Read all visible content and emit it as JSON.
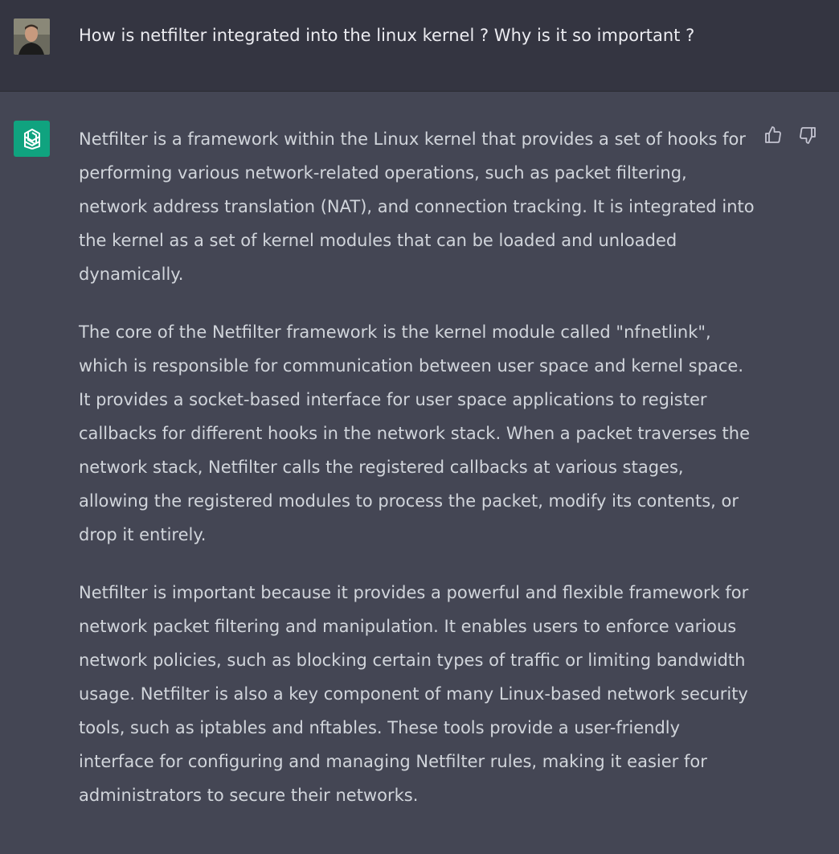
{
  "user_message": {
    "text": "How is netfilter integrated into the linux kernel ? Why is it so important ?"
  },
  "assistant_message": {
    "paragraphs": [
      "Netfilter is a framework within the Linux kernel that provides a set of hooks for performing various network-related operations, such as packet filtering, network address translation (NAT), and connection tracking. It is integrated into the kernel as a set of kernel modules that can be loaded and unloaded dynamically.",
      "The core of the Netfilter framework is the kernel module called \"nfnetlink\", which is responsible for communication between user space and kernel space. It provides a socket-based interface for user space applications to register callbacks for different hooks in the network stack. When a packet traverses the network stack, Netfilter calls the registered callbacks at various stages, allowing the registered modules to process the packet, modify its contents, or drop it entirely.",
      "Netfilter is important because it provides a powerful and flexible framework for network packet filtering and manipulation. It enables users to enforce various network policies, such as blocking certain types of traffic or limiting bandwidth usage. Netfilter is also a key component of many Linux-based network security tools, such as iptables and nftables. These tools provide a user-friendly interface for configuring and managing Netfilter rules, making it easier for administrators to secure their networks."
    ]
  },
  "icons": {
    "user_avatar": "user-avatar-photo",
    "assistant_avatar": "openai-logo-icon",
    "thumbs_up": "thumbs-up-icon",
    "thumbs_down": "thumbs-down-icon"
  },
  "colors": {
    "user_row_bg": "#343541",
    "assistant_row_bg": "#444654",
    "assistant_avatar_bg": "#10a37f",
    "text": "#d1d5db"
  }
}
